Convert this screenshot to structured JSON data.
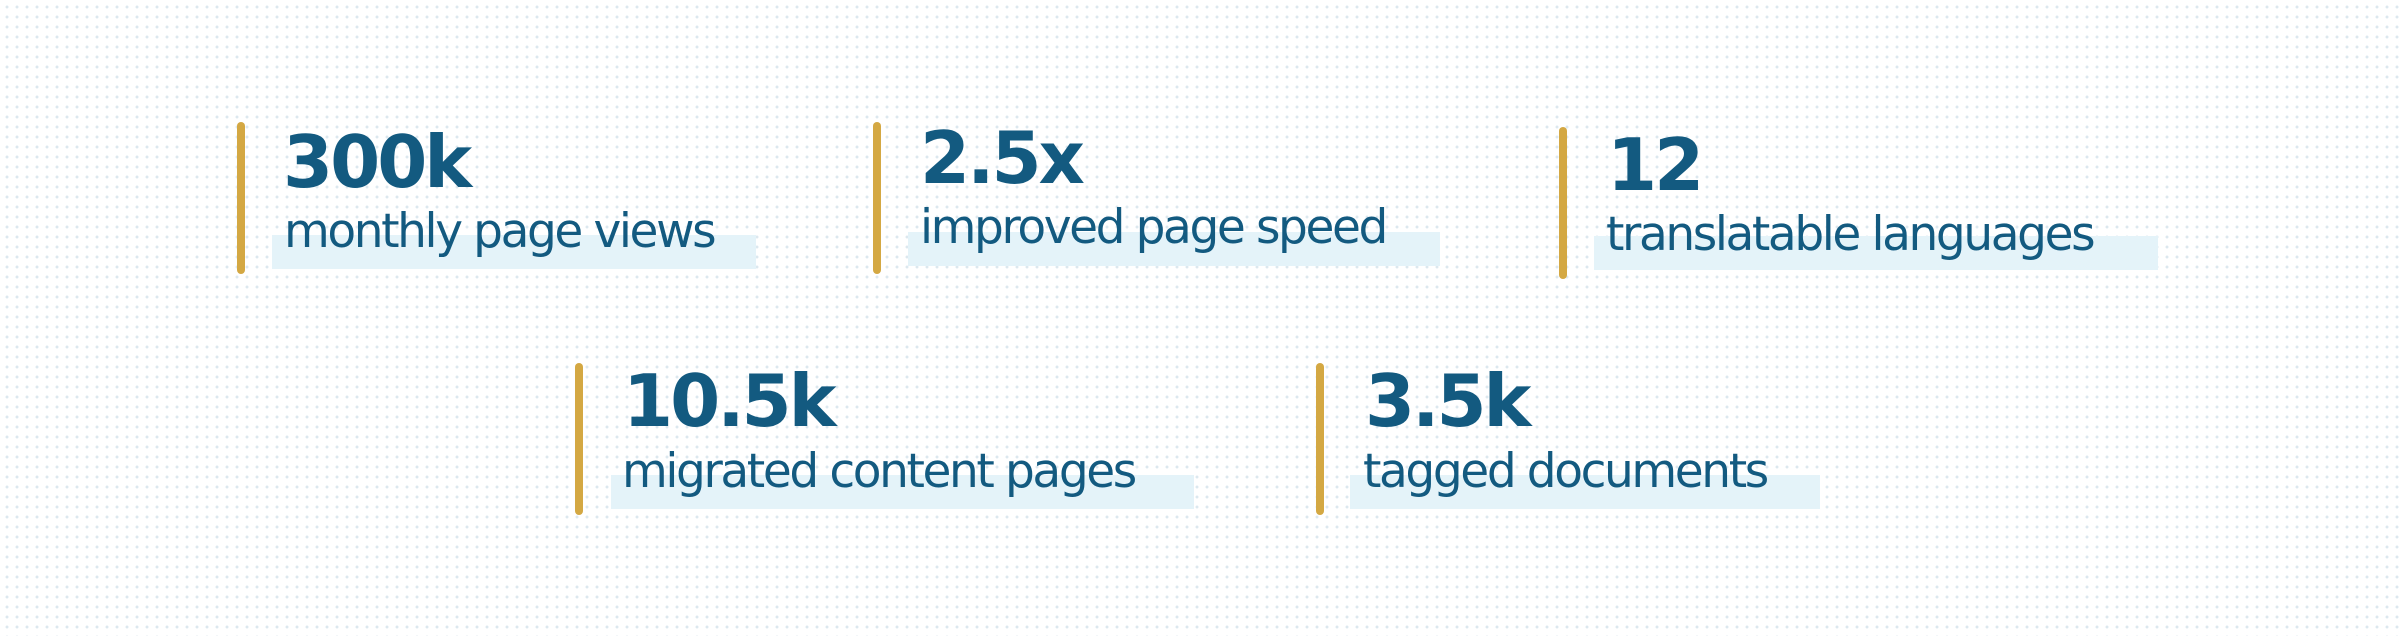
{
  "colors": {
    "accent_bar": "#d4a843",
    "text": "#135a80",
    "label_highlight": "#e4f3f9",
    "background_dots": "#dce8ef"
  },
  "stats": [
    {
      "value": "300k",
      "label": "monthly page views"
    },
    {
      "value": "2.5x",
      "label": "improved page speed"
    },
    {
      "value": "12",
      "label": "translatable languages"
    },
    {
      "value": "10.5k",
      "label": "migrated content pages"
    },
    {
      "value": "3.5k",
      "label": "tagged documents"
    }
  ]
}
